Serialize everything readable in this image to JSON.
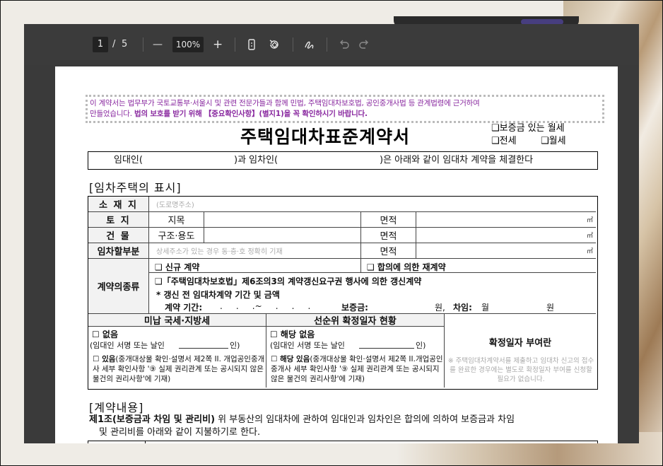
{
  "toolbar": {
    "page_current": "1",
    "page_separator": "/",
    "page_total": "5",
    "zoom_out_symbol": "—",
    "zoom_level": "100%",
    "zoom_in_symbol": "+",
    "icons": [
      "fit-page-icon",
      "rotate-icon",
      "draw-icon",
      "undo-icon",
      "redo-icon"
    ]
  },
  "document": {
    "notice_line1": "이 계약서는 법무부가 국토교통부·서울시 및 관련 전문가들과 함께 민법, 주택임대차보호법, 공인중개사법 등 관계법령에 근거하여",
    "notice_line2_a": "만들었습니다. ",
    "notice_line2_b": "법의 보호를 받기 위해 【중요확인사항】(별지1)을 꼭 확인하시기 바랍니다.",
    "title": "주택임대차표준계약서",
    "type_options": [
      "❑보증금 있는 월세",
      "❑전세",
      "❑월세"
    ],
    "parties": {
      "lessor": "임대인(",
      "mid": ")과 임차인(",
      "end": ")은 아래와 같이 임대차 계약을 체결한다"
    },
    "section1_title": "[임차주택의 표시]",
    "rows": {
      "location_label": "소 재 지",
      "location_placeholder": "(도로명주소)",
      "land_label": "토   지",
      "land_sub": "지목",
      "area_label": "면적",
      "area_unit": "㎡",
      "building_label": "건   물",
      "building_sub": "구조·용도",
      "rented_label": "임차할부분",
      "rented_placeholder": "상세주소가 있는 경우 동·층·호 정확히 기재"
    },
    "contract_type": {
      "label": "계약의종류",
      "new": "❑ 신규 계약",
      "renewal_agreed": "❑ 합의에 의한 재계약",
      "renewal_right": "❑「주택임대차보호법」제6조의3의 계약갱신요구권 행사에 의한 갱신계약",
      "prior_title": "* 갱신 전 임대차계약 기간 및 금액",
      "prior_period": "계약 기간:",
      "prior_period_blank": ".     .     .~     .     .     .",
      "prior_deposit": "보증금:",
      "won1": "원,",
      "prior_rent": "차임:",
      "monthly": "월",
      "won2": "원"
    },
    "tax": {
      "header": "미납 국세·지방세",
      "none": "☐ 없음",
      "sign": "(임대인 서명 또는 날인",
      "sign_end": "인)",
      "exists_bold": "☐ 있음",
      "exists_text": "(중개대상물 확인·설명서 제2쪽 II. 개업공인중개사 세부 확인사항 '⑨ 실제 권리관계 또는 공시되지 않은 물건의 권리사항'에 기재)"
    },
    "priority": {
      "header": "선순위 확정일자 현황",
      "none": "☐ 해당 없음",
      "sign": "(임대인 서명 또는 날인",
      "sign_end": "인)",
      "exists_bold": "☐ 해당 있음",
      "exists_text": "(중개대상물 확인·설명서 제2쪽 II.개업공인중개사 세부 확인사항 '⑨ 실제 권리관계 또는 공시되지 않은 물건의 권리사항'에 기재)"
    },
    "fixed_date": {
      "header": "확정일자 부여란",
      "note": "※ 주택임대차계약서를 제출하고 임대차 신고의 접수를 완료한 경우에는 별도로 확정일자 부여를 신청할 필요가 없습니다."
    },
    "section2_title": "[계약내용]",
    "article1_bold": "제1조(보증금과 차임 및 관리비)",
    "article1_text": " 위 부동산의 임대차에 관하여 임대인과 임차인은 합의에 의하여 보증금과 차임",
    "article1_text2": "및 관리비를 아래와 같이 지불하기로 한다."
  }
}
